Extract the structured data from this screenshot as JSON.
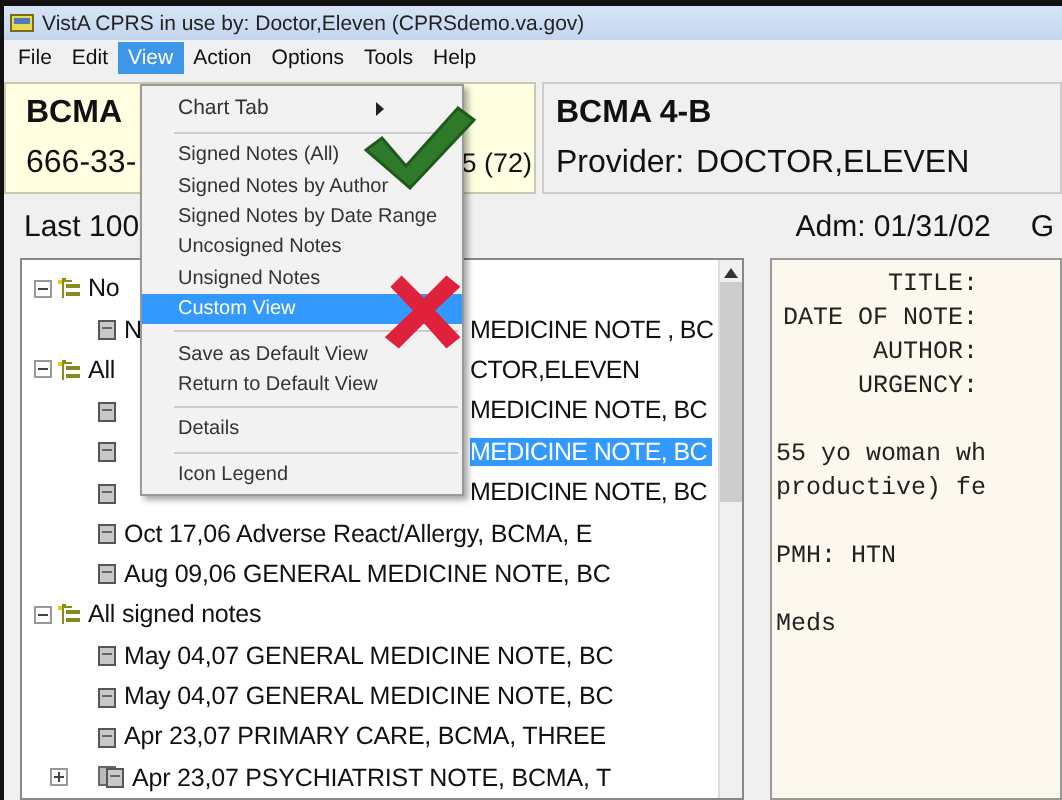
{
  "window": {
    "title": "VistA CPRS in use by: Doctor,Eleven  (CPRSdemo.va.gov)"
  },
  "menu_bar": [
    {
      "label": "File",
      "selected": false
    },
    {
      "label": "Edit",
      "selected": false
    },
    {
      "label": "View",
      "selected": true
    },
    {
      "label": "Action",
      "selected": false
    },
    {
      "label": "Options",
      "selected": false
    },
    {
      "label": "Tools",
      "selected": false
    },
    {
      "label": "Help",
      "selected": false
    }
  ],
  "patient": {
    "name": "BCMA",
    "ssn": "666-33-",
    "age": "5 (72)"
  },
  "location": {
    "ward": "BCMA 4-B",
    "provider_label": "Provider:",
    "provider": "DOCTOR,ELEVEN"
  },
  "notes_heading": "Last 100",
  "admission": {
    "label": "Adm: 01/31/02",
    "column_2": "G"
  },
  "tree": [
    {
      "label": "No",
      "expanded": true,
      "children": [
        {
          "kind": "note",
          "label": "N",
          "tail": "MEDICINE NOTE , BC",
          "selected": false
        }
      ]
    },
    {
      "label": "All",
      "tail": "CTOR,ELEVEN",
      "expanded": true,
      "children": [
        {
          "kind": "note",
          "tail": "MEDICINE NOTE, BC",
          "selected": false
        },
        {
          "kind": "note",
          "tail": "MEDICINE NOTE, BC",
          "selected": true
        },
        {
          "kind": "note",
          "tail": "MEDICINE NOTE, BC",
          "selected": false
        },
        {
          "kind": "note",
          "label": "Oct 17,06  Adverse React/Allergy, BCMA, E",
          "selected": false
        },
        {
          "kind": "note",
          "label": "Aug 09,06  GENERAL MEDICINE NOTE, BC",
          "selected": false
        }
      ]
    },
    {
      "label": "All signed notes",
      "expanded": true,
      "children": [
        {
          "kind": "note",
          "label": "May 04,07  GENERAL MEDICINE NOTE, BC",
          "selected": false
        },
        {
          "kind": "note",
          "label": "May 04,07  GENERAL MEDICINE NOTE, BC",
          "selected": false
        },
        {
          "kind": "note",
          "label": "Apr 23,07  PRIMARY CARE, BCMA, THREE",
          "selected": false
        },
        {
          "kind": "parent-note",
          "expanded": false,
          "label": "Apr 23,07  PSYCHIATRIST NOTE, BCMA, T",
          "selected": false
        }
      ]
    }
  ],
  "note": {
    "fields": [
      "TITLE:",
      "DATE OF NOTE:",
      "AUTHOR:",
      "URGENCY:"
    ],
    "paragraphs": [
      [
        "55 yo woman wh",
        "productive) fe"
      ],
      [
        "PMH: HTN"
      ],
      [
        "Meds"
      ]
    ]
  },
  "view_menu": [
    {
      "kind": "submenu",
      "label": "Chart Tab",
      "selected": false
    },
    {
      "kind": "separator"
    },
    {
      "kind": "item",
      "label": "Signed Notes (All)",
      "selected": false
    },
    {
      "kind": "item",
      "label": "Signed Notes by Author",
      "selected": false
    },
    {
      "kind": "item",
      "label": "Signed Notes by Date Range",
      "selected": false
    },
    {
      "kind": "item",
      "label": "Uncosigned Notes",
      "selected": false
    },
    {
      "kind": "item",
      "label": "Unsigned Notes",
      "selected": false
    },
    {
      "kind": "item",
      "label": "Custom View",
      "selected": true
    },
    {
      "kind": "separator"
    },
    {
      "kind": "item",
      "label": "Save as Default View",
      "selected": false
    },
    {
      "kind": "item",
      "label": "Return to Default View",
      "selected": false
    },
    {
      "kind": "separator"
    },
    {
      "kind": "item",
      "label": "Details",
      "selected": false
    },
    {
      "kind": "separator"
    },
    {
      "kind": "item",
      "label": "Icon Legend",
      "selected": false
    }
  ]
}
